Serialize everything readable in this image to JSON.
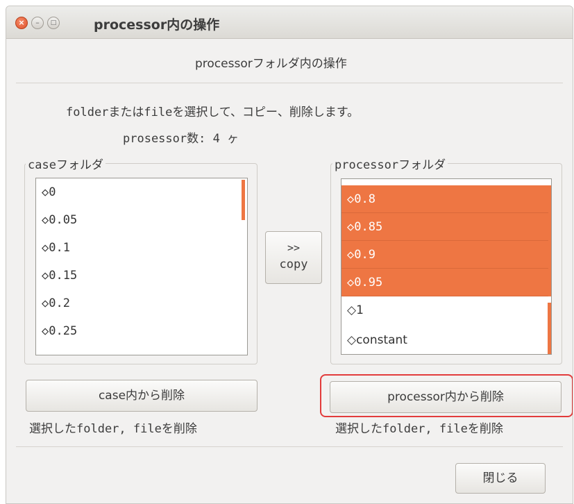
{
  "window": {
    "title": "processor内の操作",
    "close_icon": "×",
    "minimize_icon": "–",
    "maximize_icon": "□"
  },
  "header": {
    "section_title": "processorフォルダ内の操作",
    "instruction": "folderまたはfileを選択して、コピー、削除します。",
    "processor_count_label": "prosessor数: 4 ヶ"
  },
  "case_panel": {
    "label": "caseフォルダ",
    "items": [
      "◇0",
      "◇0.05",
      "◇0.1",
      "◇0.15",
      "◇0.2",
      "◇0.25"
    ],
    "delete_button": "case内から削除",
    "note": "選択したfolder, fileを削除"
  },
  "copy_button": {
    "arrow": ">>",
    "label": "copy"
  },
  "processor_panel": {
    "label": "processorフォルダ",
    "items": [
      {
        "text": "◇0.8",
        "selected": true
      },
      {
        "text": "◇0.85",
        "selected": true
      },
      {
        "text": "◇0.9",
        "selected": true
      },
      {
        "text": "◇0.95",
        "selected": true
      },
      {
        "text": "◇1",
        "selected": false
      },
      {
        "text": "◇constant",
        "selected": false
      }
    ],
    "delete_button": "processor内から削除",
    "note": "選択したfolder, fileを削除"
  },
  "footer": {
    "close_button": "閉じる"
  },
  "colors": {
    "selection": "#ee7643",
    "annotation_highlight": "#e23b3b"
  }
}
